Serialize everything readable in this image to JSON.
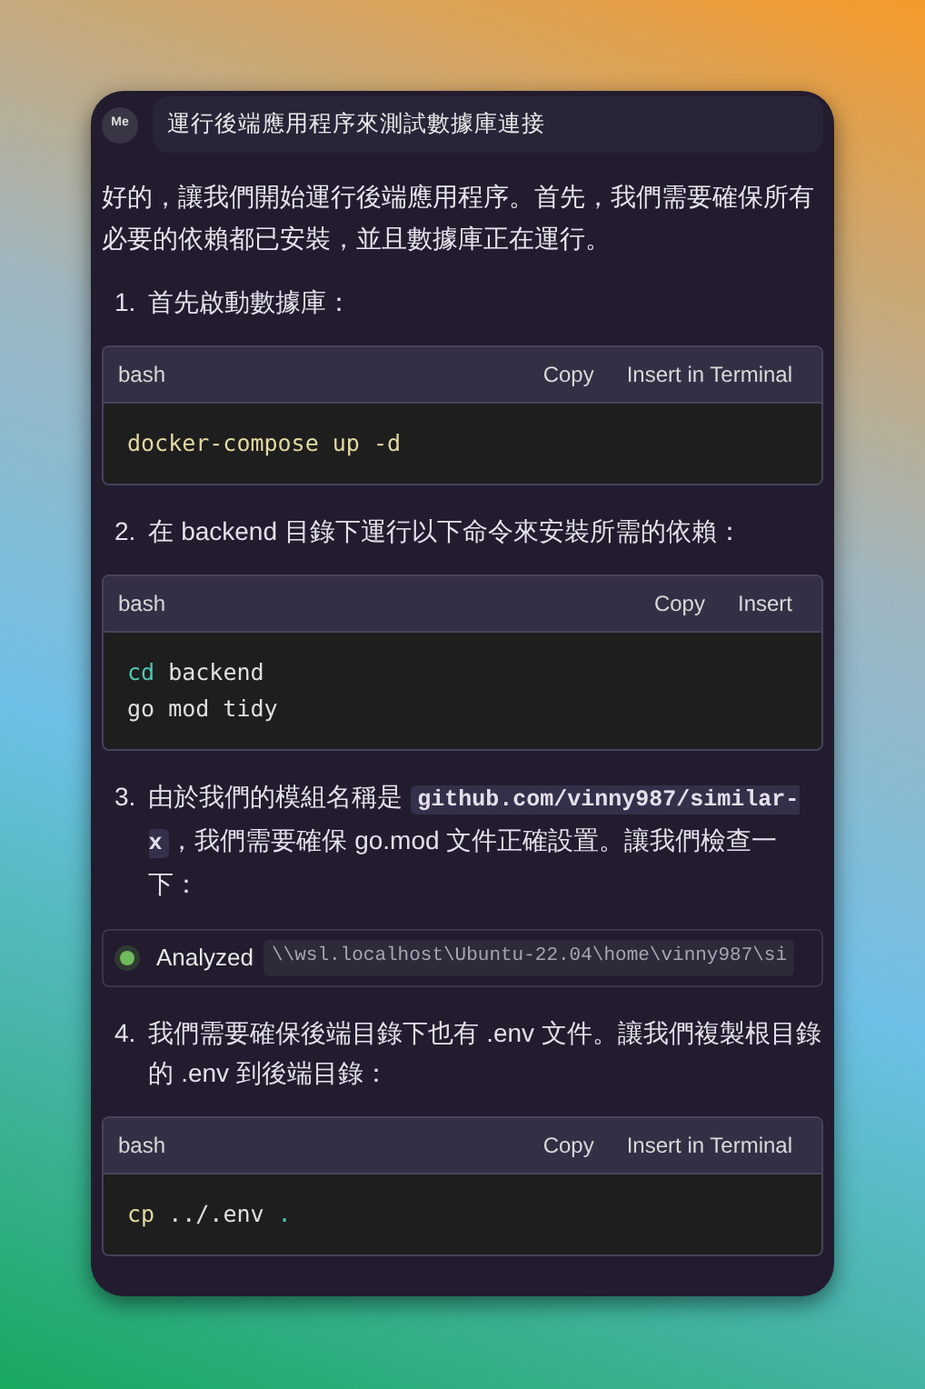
{
  "header": {
    "avatar": "Me",
    "title": "運行後端應用程序來測試數據庫連接"
  },
  "intro": "好的，讓我們開始運行後端應用程序。首先，我們需要確保所有必要的依賴都已安裝，並且數據庫正在運行。",
  "steps": [
    {
      "kind": "code",
      "number": "1.",
      "parts": [
        {
          "kind": "text",
          "text": "首先啟動數據庫："
        }
      ],
      "block": {
        "language": "bash",
        "actions": [
          "Copy",
          "Insert in Terminal"
        ],
        "lines": [
          [
            {
              "kind": "command",
              "text": "docker-compose up -d"
            }
          ]
        ]
      }
    },
    {
      "kind": "code",
      "number": "2.",
      "parts": [
        {
          "kind": "text",
          "text": "在 backend 目錄下運行以下命令來安裝所需的依賴："
        }
      ],
      "block": {
        "language": "bash",
        "actions": [
          "Copy",
          "Insert"
        ],
        "lines": [
          [
            {
              "kind": "builtin",
              "text": "cd"
            },
            {
              "kind": "arg",
              "text": " backend"
            }
          ],
          [
            {
              "kind": "arg",
              "text": "go mod tidy"
            }
          ]
        ]
      }
    },
    {
      "kind": "analyzed",
      "number": "3.",
      "parts": [
        {
          "kind": "text",
          "text": "由於我們的模組名稱是 "
        },
        {
          "kind": "code",
          "text": "github.com/vinny987/similar-x"
        },
        {
          "kind": "text",
          "text": "，我們需要確保 go.mod 文件正確設置。讓我們檢查一下："
        }
      ],
      "status": {
        "label": "Analyzed",
        "path": "\\\\wsl.localhost\\Ubuntu-22.04\\home\\vinny987\\si"
      }
    },
    {
      "kind": "code",
      "number": "4.",
      "parts": [
        {
          "kind": "text",
          "text": "我們需要確保後端目錄下也有 .env 文件。讓我們複製根目錄的 .env 到後端目錄："
        }
      ],
      "block": {
        "language": "bash",
        "actions": [
          "Copy",
          "Insert in Terminal"
        ],
        "lines": [
          [
            {
              "kind": "command",
              "text": "cp"
            },
            {
              "kind": "arg",
              "text": " ../.env "
            },
            {
              "kind": "builtin",
              "text": "."
            }
          ]
        ]
      }
    }
  ]
}
